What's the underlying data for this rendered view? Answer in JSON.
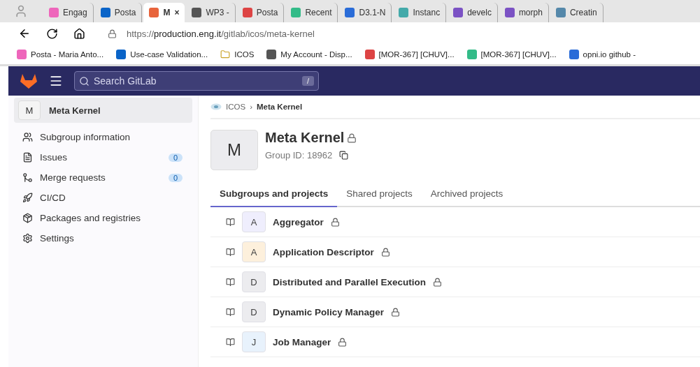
{
  "browser_tabs": [
    {
      "label": "Engag",
      "selected": false
    },
    {
      "label": "Posta",
      "selected": false
    },
    {
      "label": "M",
      "selected": true
    },
    {
      "label": "WP3 -",
      "selected": false
    },
    {
      "label": "Posta",
      "selected": false
    },
    {
      "label": "Recent",
      "selected": false
    },
    {
      "label": "D3.1-N",
      "selected": false
    },
    {
      "label": "Instanc",
      "selected": false
    },
    {
      "label": "develc",
      "selected": false
    },
    {
      "label": "morph",
      "selected": false
    },
    {
      "label": "Creatin",
      "selected": false
    }
  ],
  "close_tab": "×",
  "url": {
    "scheme": "https://",
    "host": "production.eng.it",
    "path": "/gitlab/icos/meta-kernel"
  },
  "bookmarks": [
    "Posta - Maria Anto...",
    "Use-case Validation...",
    "ICOS",
    "My Account - Disp...",
    "[MOR-367] [CHUV]...",
    "[MOR-367] [CHUV]...",
    "opni.io github -"
  ],
  "header": {
    "search_placeholder": "Search GitLab",
    "shortcut": "/"
  },
  "sidebar": {
    "group": {
      "avatar": "M",
      "name": "Meta Kernel"
    },
    "items": [
      {
        "label": "Subgroup information",
        "kind": "subgroup"
      },
      {
        "label": "Issues",
        "kind": "issues",
        "count": "0"
      },
      {
        "label": "Merge requests",
        "kind": "merge",
        "count": "0"
      },
      {
        "label": "CI/CD",
        "kind": "pipeline"
      },
      {
        "label": "Packages and registries",
        "kind": "package"
      },
      {
        "label": "Settings",
        "kind": "settings"
      }
    ]
  },
  "breadcrumb": [
    "ICOS",
    "Meta Kernel"
  ],
  "breadcrumb_separator": "›",
  "group": {
    "avatar": "M",
    "name": "Meta Kernel",
    "group_id": "Group ID: 18962"
  },
  "tabs": [
    {
      "label": "Subgroups and projects",
      "selected": true
    },
    {
      "label": "Shared projects",
      "selected": false
    },
    {
      "label": "Archived projects",
      "selected": false
    }
  ],
  "projects": [
    {
      "avatar": "A",
      "name": "Aggregator",
      "color": "#efeefd"
    },
    {
      "avatar": "A",
      "name": "Application Descriptor",
      "color": "#fdf0dc"
    },
    {
      "avatar": "D",
      "name": "Distributed and Parallel Execution",
      "color": "#ececef"
    },
    {
      "avatar": "D",
      "name": "Dynamic Policy Manager",
      "color": "#ececef"
    },
    {
      "avatar": "J",
      "name": "Job Manager",
      "color": "#e8f2fc"
    }
  ]
}
